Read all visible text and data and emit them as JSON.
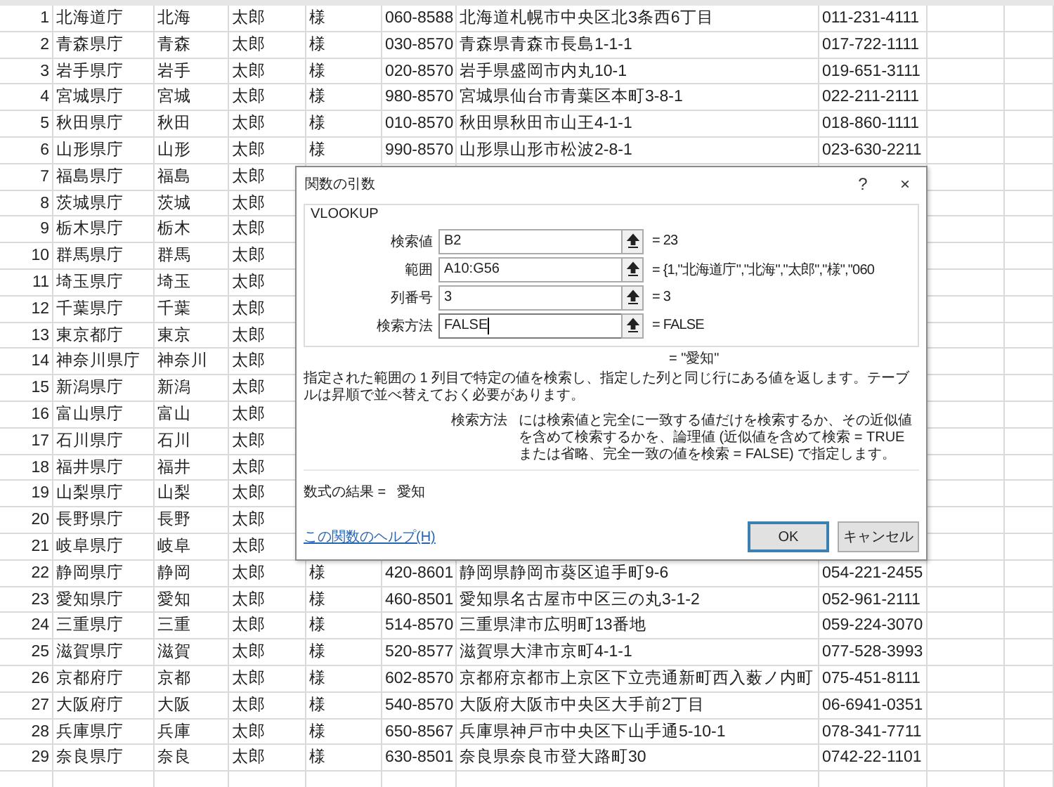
{
  "sheet": {
    "rows": [
      {
        "cells": [
          "1",
          "北海道庁",
          "北海",
          "太郎",
          "様",
          "060-8588",
          "北海道札幌市中央区北3条西6丁目",
          "011-231-4111"
        ]
      },
      {
        "cells": [
          "2",
          "青森県庁",
          "青森",
          "太郎",
          "様",
          "030-8570",
          "青森県青森市長島1-1-1",
          "017-722-1111"
        ]
      },
      {
        "cells": [
          "3",
          "岩手県庁",
          "岩手",
          "太郎",
          "様",
          "020-8570",
          "岩手県盛岡市内丸10-1",
          "019-651-3111"
        ]
      },
      {
        "cells": [
          "4",
          "宮城県庁",
          "宮城",
          "太郎",
          "様",
          "980-8570",
          "宮城県仙台市青葉区本町3-8-1",
          "022-211-2111"
        ]
      },
      {
        "cells": [
          "5",
          "秋田県庁",
          "秋田",
          "太郎",
          "様",
          "010-8570",
          "秋田県秋田市山王4-1-1",
          "018-860-1111"
        ]
      },
      {
        "cells": [
          "6",
          "山形県庁",
          "山形",
          "太郎",
          "様",
          "990-8570",
          "山形県山形市松波2-8-1",
          "023-630-2211"
        ]
      },
      {
        "cells": [
          "7",
          "福島県庁",
          "福島",
          "太郎"
        ]
      },
      {
        "cells": [
          "8",
          "茨城県庁",
          "茨城",
          "太郎"
        ]
      },
      {
        "cells": [
          "9",
          "栃木県庁",
          "栃木",
          "太郎"
        ]
      },
      {
        "cells": [
          "10",
          "群馬県庁",
          "群馬",
          "太郎"
        ]
      },
      {
        "cells": [
          "11",
          "埼玉県庁",
          "埼玉",
          "太郎"
        ]
      },
      {
        "cells": [
          "12",
          "千葉県庁",
          "千葉",
          "太郎"
        ]
      },
      {
        "cells": [
          "13",
          "東京都庁",
          "東京",
          "太郎"
        ]
      },
      {
        "cells": [
          "14",
          "神奈川県庁",
          "神奈川",
          "太郎"
        ]
      },
      {
        "cells": [
          "15",
          "新潟県庁",
          "新潟",
          "太郎"
        ]
      },
      {
        "cells": [
          "16",
          "富山県庁",
          "富山",
          "太郎"
        ]
      },
      {
        "cells": [
          "17",
          "石川県庁",
          "石川",
          "太郎"
        ]
      },
      {
        "cells": [
          "18",
          "福井県庁",
          "福井",
          "太郎"
        ]
      },
      {
        "cells": [
          "19",
          "山梨県庁",
          "山梨",
          "太郎"
        ]
      },
      {
        "cells": [
          "20",
          "長野県庁",
          "長野",
          "太郎"
        ]
      },
      {
        "cells": [
          "21",
          "岐阜県庁",
          "岐阜",
          "太郎"
        ]
      },
      {
        "cells": [
          "22",
          "静岡県庁",
          "静岡",
          "太郎",
          "様",
          "420-8601",
          "静岡県静岡市葵区追手町9-6",
          "054-221-2455"
        ]
      },
      {
        "cells": [
          "23",
          "愛知県庁",
          "愛知",
          "太郎",
          "様",
          "460-8501",
          "愛知県名古屋市中区三の丸3-1-2",
          "052-961-2111"
        ]
      },
      {
        "cells": [
          "24",
          "三重県庁",
          "三重",
          "太郎",
          "様",
          "514-8570",
          "三重県津市広明町13番地",
          "059-224-3070"
        ]
      },
      {
        "cells": [
          "25",
          "滋賀県庁",
          "滋賀",
          "太郎",
          "様",
          "520-8577",
          "滋賀県大津市京町4-1-1",
          "077-528-3993"
        ]
      },
      {
        "cells": [
          "26",
          "京都府庁",
          "京都",
          "太郎",
          "様",
          "602-8570",
          "京都府京都市上京区下立売通新町西入薮ノ内町",
          "075-451-8111"
        ]
      },
      {
        "cells": [
          "27",
          "大阪府庁",
          "大阪",
          "太郎",
          "様",
          "540-8570",
          "大阪府大阪市中央区大手前2丁目",
          "06-6941-0351"
        ]
      },
      {
        "cells": [
          "28",
          "兵庫県庁",
          "兵庫",
          "太郎",
          "様",
          "650-8567",
          "兵庫県神戸市中央区下山手通5-10-1",
          "078-341-7711"
        ]
      },
      {
        "cells": [
          "29",
          "奈良県庁",
          "奈良",
          "太郎",
          "様",
          "630-8501",
          "奈良県奈良市登大路町30",
          "0742-22-1101"
        ]
      }
    ]
  },
  "dialog": {
    "title": "関数の引数",
    "help_button": "?",
    "close_button": "×",
    "function_name": "VLOOKUP",
    "arguments": [
      {
        "label": "検索値",
        "value": "B2",
        "result": "= 23",
        "focused": false
      },
      {
        "label": "範囲",
        "value": "A10:G56",
        "result": "= {1,\"北海道庁\",\"北海\",\"太郎\",\"様\",\"060",
        "focused": false
      },
      {
        "label": "列番号",
        "value": "3",
        "result": "= 3",
        "focused": false
      },
      {
        "label": "検索方法",
        "value": "FALSE",
        "result": "= FALSE",
        "focused": true
      }
    ],
    "function_result": "= \"愛知\"",
    "description": "指定された範囲の 1 列目で特定の値を検索し、指定した列と同じ行にある値を返します。テーブルは昇順で並べ替えておく必要があります。",
    "argument_help": {
      "label": "検索方法",
      "text": "には検索値と完全に一致する値だけを検索するか、その近似値を含めて検索するかを、論理値 (近似値を含めて検索 = TRUE または省略、完全一致の値を検索 = FALSE) で指定します。"
    },
    "formula_result": {
      "label": "数式の結果 =",
      "value": "愛知"
    },
    "help_link": "この関数のヘルプ(H)",
    "buttons": [
      {
        "label": "OK",
        "default": true
      },
      {
        "label": "キャンセル",
        "default": false
      }
    ]
  }
}
